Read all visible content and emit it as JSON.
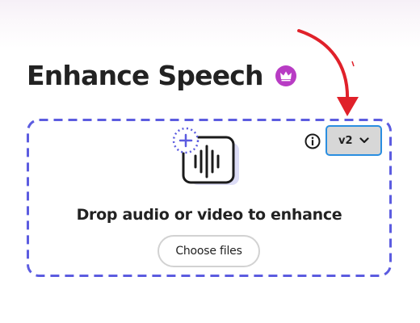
{
  "page": {
    "title": "Enhance Speech"
  },
  "version_select": {
    "value": "v2"
  },
  "drop_zone": {
    "label": "Drop audio or video to enhance",
    "choose_files_label": "Choose files"
  },
  "icons": {
    "premium": "crown-icon",
    "info": "info-icon",
    "chevron": "chevron-down-icon",
    "upload": "audio-waveform-add-icon",
    "annotation": "red-arrow-pointer"
  },
  "colors": {
    "accent_dashed_border": "#5c5ce0",
    "premium_badge": "#b83cc4",
    "annotation_arrow": "#e0212a",
    "select_focus": "#2a8ee0"
  }
}
